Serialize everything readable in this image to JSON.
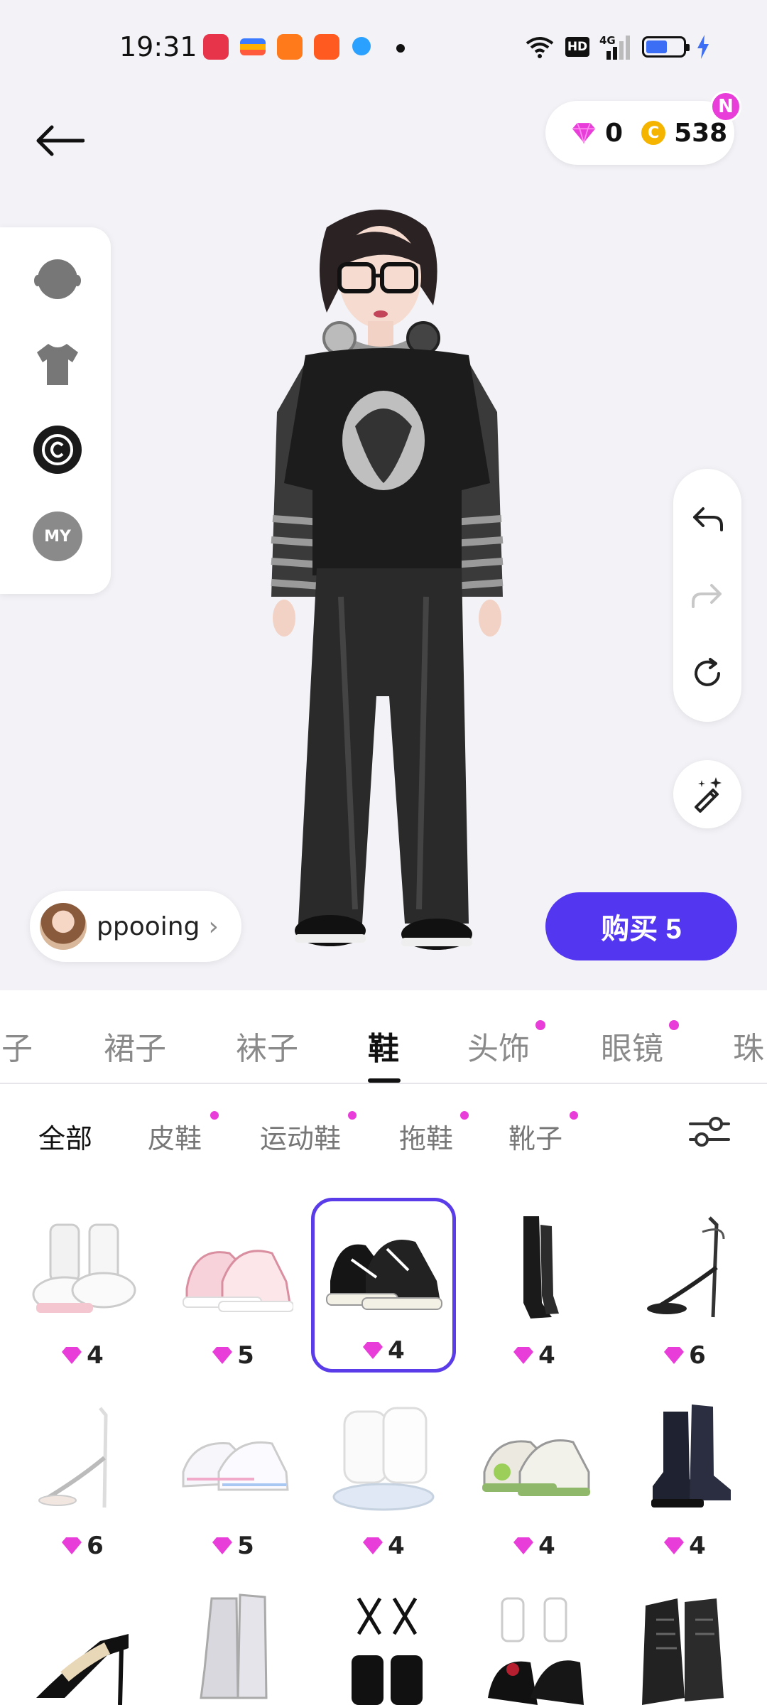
{
  "status": {
    "time": "19:31",
    "network": "4G"
  },
  "header": {
    "gems": "0",
    "coins": "538",
    "coin_symbol": "C",
    "new_badge": "N"
  },
  "side_panel": {
    "my_label": "MY"
  },
  "user": {
    "name": "ppooing",
    "chevron": "›"
  },
  "buy_button": "购买 5",
  "categories": [
    "子",
    "裙子",
    "袜子",
    "鞋",
    "头饰",
    "眼镜",
    "珠"
  ],
  "subcategories": [
    "全部",
    "皮鞋",
    "运动鞋",
    "拖鞋",
    "靴子"
  ],
  "items": [
    {
      "price": "4",
      "icon": "white-platform-shoe-icon"
    },
    {
      "price": "5",
      "icon": "pink-sneaker-icon"
    },
    {
      "price": "4",
      "icon": "black-canvas-sneaker-icon",
      "selected": true
    },
    {
      "price": "4",
      "icon": "black-knee-boot-icon"
    },
    {
      "price": "6",
      "icon": "black-heel-sandal-icon"
    },
    {
      "price": "6",
      "icon": "white-heel-sandal-icon"
    },
    {
      "price": "5",
      "icon": "white-sneaker-icon"
    },
    {
      "price": "4",
      "icon": "white-knit-boot-icon"
    },
    {
      "price": "4",
      "icon": "green-sneaker-icon"
    },
    {
      "price": "4",
      "icon": "black-combat-boot-icon"
    },
    {
      "icon": "black-pump-icon"
    },
    {
      "icon": "silver-boot-icon"
    },
    {
      "icon": "black-strappy-heel-icon"
    },
    {
      "icon": "black-mary-jane-icon"
    },
    {
      "icon": "black-lace-boot-icon"
    }
  ],
  "colors": {
    "accent": "#5336f0",
    "gem": "#e83dd8",
    "coin": "#f4b400"
  }
}
